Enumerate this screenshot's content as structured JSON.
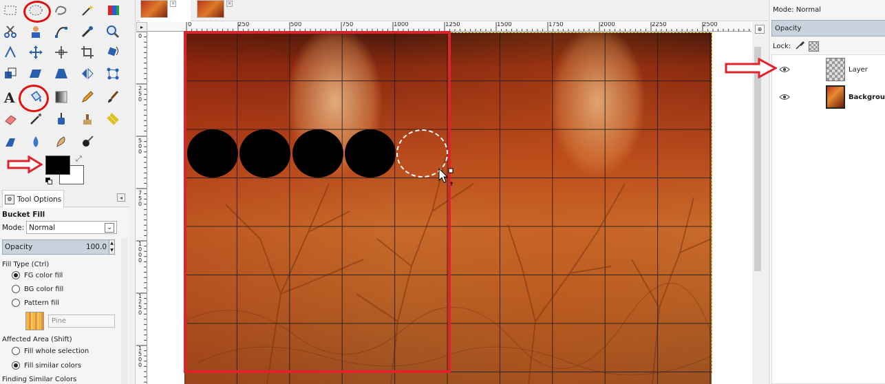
{
  "tool_options": {
    "tab_label": "Tool Options",
    "title": "Bucket Fill",
    "mode_label": "Mode:",
    "mode_value": "Normal",
    "opacity_label": "Opacity",
    "opacity_value": "100.0",
    "fill_type_label": "Fill Type  (Ctrl)",
    "fill_type_options": [
      "FG color fill",
      "BG color fill",
      "Pattern fill"
    ],
    "fill_type_selected": "FG color fill",
    "pattern_name": "Pine",
    "affected_area_label": "Affected Area  (Shift)",
    "affected_area_options": [
      "Fill whole selection",
      "Fill similar colors"
    ],
    "affected_area_selected": "Fill similar colors",
    "finding_label": "Finding Similar Colors"
  },
  "colors": {
    "foreground": "#000000",
    "background": "#ffffff",
    "annotation_red": "#e0222a"
  },
  "ruler": {
    "horizontal_labels": [
      "0",
      "250",
      "500",
      "750",
      "1000",
      "1250",
      "1500",
      "1750",
      "2000",
      "2250",
      "2500"
    ],
    "vertical_labels": [
      "0",
      "250",
      "500",
      "750",
      "1000",
      "1250",
      "1500"
    ]
  },
  "layers": {
    "mode_text": "Mode: Normal",
    "opacity_label": "Opacity",
    "lock_label": "Lock:",
    "items": [
      {
        "name": "Layer",
        "visible": true
      },
      {
        "name": "Background",
        "visible": true
      }
    ]
  },
  "canvas": {
    "filled_circles": 4,
    "selection_shape": "ellipse"
  },
  "icons": {
    "toolbox": [
      "rect-select-icon",
      "ellipse-select-icon",
      "free-select-icon",
      "fuzzy-select-icon",
      "select-by-color-icon",
      "scissors-select-icon",
      "foreground-select-icon",
      "paths-icon",
      "color-picker-icon",
      "zoom-icon",
      "measure-icon",
      "move-icon",
      "align-icon",
      "crop-icon",
      "rotate-icon",
      "scale-icon",
      "shear-icon",
      "perspective-icon",
      "flip-icon",
      "cage-transform-icon",
      "text-icon",
      "bucket-fill-icon",
      "blend-icon",
      "pencil-icon",
      "paintbrush-icon",
      "eraser-icon",
      "airbrush-icon",
      "ink-icon",
      "clone-icon",
      "heal-icon",
      "perspective-clone-icon",
      "blur-icon",
      "smudge-icon",
      "dodge-burn-icon"
    ]
  }
}
